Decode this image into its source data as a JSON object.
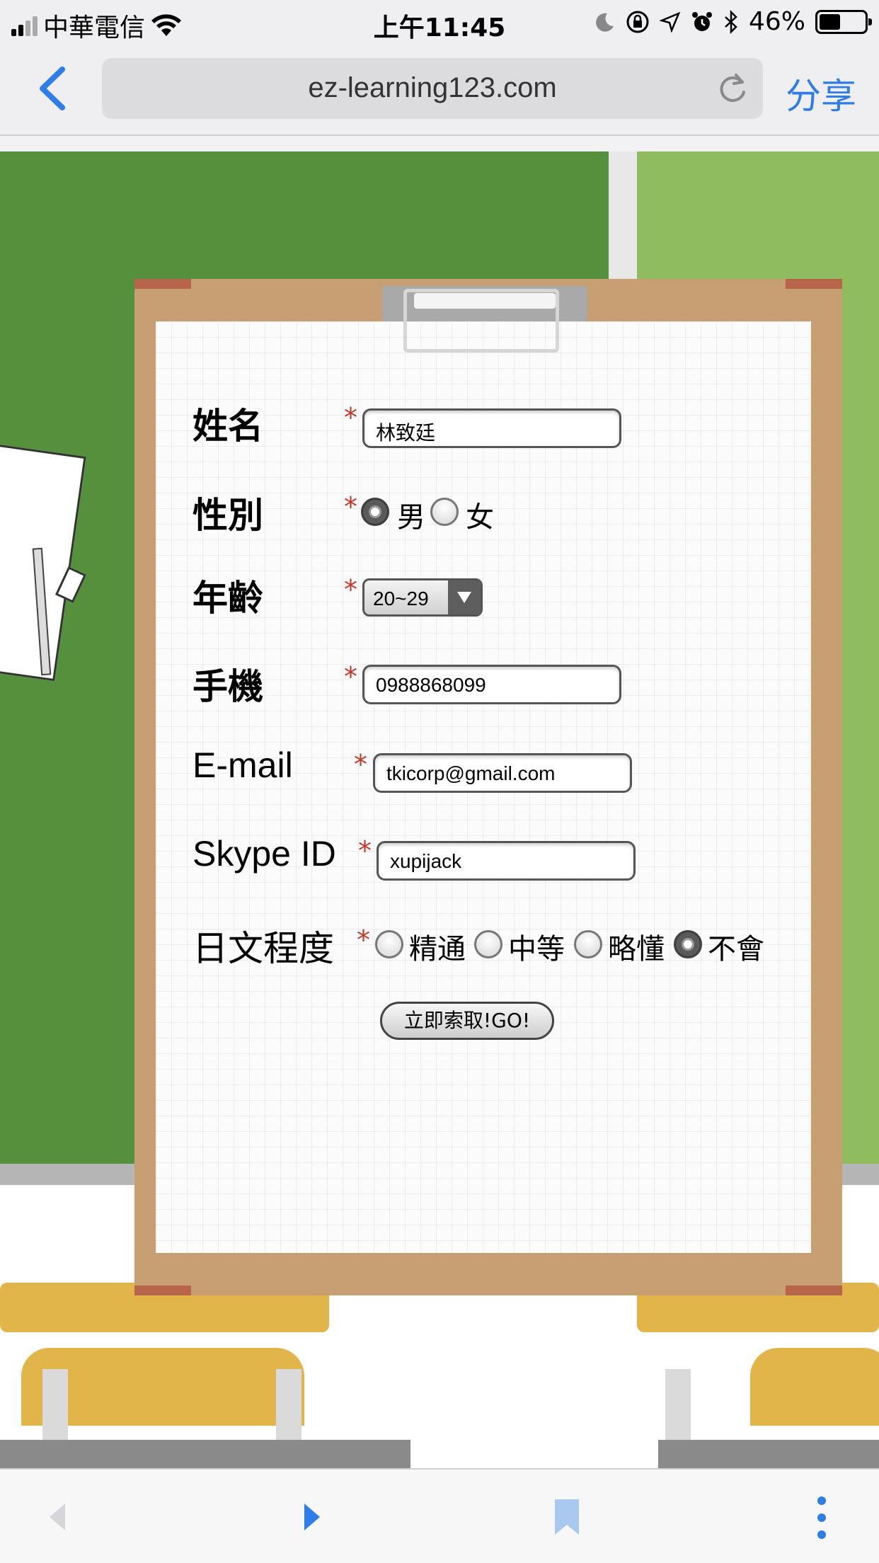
{
  "status_bar": {
    "carrier": "中華電信",
    "time": "上午11:45",
    "battery": "46%",
    "battery_level": 0.46
  },
  "browser": {
    "url": "ez-learning123.com",
    "share_label": "分享"
  },
  "form": {
    "required_mark": "*",
    "name": {
      "label": "姓名",
      "value": "林致廷"
    },
    "gender": {
      "label": "性別",
      "options": [
        "男",
        "女"
      ],
      "selected": "男"
    },
    "age": {
      "label": "年齡",
      "value": "20~29"
    },
    "phone": {
      "label": "手機",
      "value": "0988868099"
    },
    "email": {
      "label": "E-mail",
      "value": "tkicorp@gmail.com"
    },
    "skype": {
      "label": "Skype ID",
      "value": "xupijack"
    },
    "japanese": {
      "label": "日文程度",
      "options": [
        "精通",
        "中等",
        "略懂",
        "不會"
      ],
      "selected": "不會"
    },
    "submit_label": "立即索取!GO!"
  },
  "colors": {
    "accent": "#2f7ee8",
    "required": "#c0392b",
    "board": "#55913d",
    "clipboard": "#c89f73",
    "desk": "#e2b54a"
  },
  "toolbar": {
    "icons": [
      "back-icon",
      "forward-icon",
      "bookmark-icon",
      "more-icon"
    ]
  }
}
